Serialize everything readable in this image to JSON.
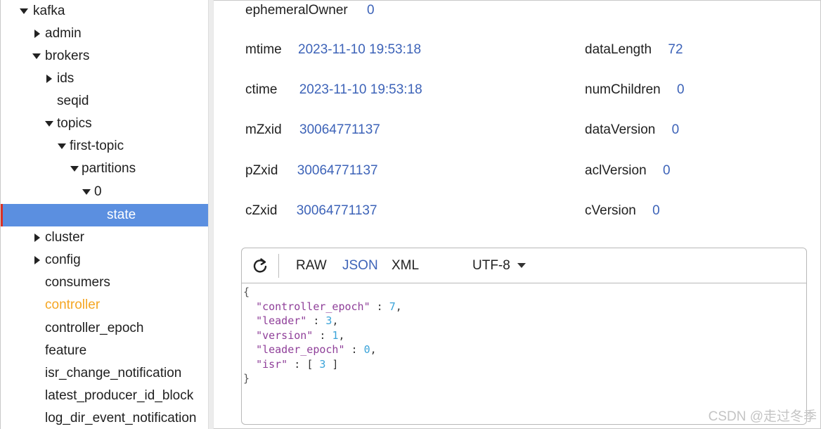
{
  "tree": {
    "items": [
      {
        "label": "kafka",
        "arrow": "down"
      },
      {
        "label": "admin",
        "arrow": "right"
      },
      {
        "label": "brokers",
        "arrow": "down"
      },
      {
        "label": "ids",
        "arrow": "right"
      },
      {
        "label": "seqid",
        "arrow": "none"
      },
      {
        "label": "topics",
        "arrow": "down"
      },
      {
        "label": "first-topic",
        "arrow": "down"
      },
      {
        "label": "partitions",
        "arrow": "down"
      },
      {
        "label": "0",
        "arrow": "down"
      },
      {
        "label": "state",
        "arrow": "none",
        "selected": true
      },
      {
        "label": "cluster",
        "arrow": "right"
      },
      {
        "label": "config",
        "arrow": "right"
      },
      {
        "label": "consumers",
        "arrow": "none"
      },
      {
        "label": "controller",
        "arrow": "none",
        "highlight": true
      },
      {
        "label": "controller_epoch",
        "arrow": "none"
      },
      {
        "label": "feature",
        "arrow": "none"
      },
      {
        "label": "isr_change_notification",
        "arrow": "none"
      },
      {
        "label": "latest_producer_id_block",
        "arrow": "none"
      },
      {
        "label": "log_dir_event_notification",
        "arrow": "none"
      }
    ]
  },
  "stat": {
    "ephemeralOwner": {
      "label": "ephemeralOwner",
      "value": "0"
    },
    "mtime": {
      "label": "mtime",
      "value": "2023-11-10 19:53:18"
    },
    "ctime": {
      "label": "ctime",
      "value": "2023-11-10 19:53:18"
    },
    "mZxid": {
      "label": "mZxid",
      "value": "30064771137"
    },
    "pZxid": {
      "label": "pZxid",
      "value": "30064771137"
    },
    "cZxid": {
      "label": "cZxid",
      "value": "30064771137"
    },
    "dataLength": {
      "label": "dataLength",
      "value": "72"
    },
    "numChildren": {
      "label": "numChildren",
      "value": "0"
    },
    "dataVersion": {
      "label": "dataVersion",
      "value": "0"
    },
    "aclVersion": {
      "label": "aclVersion",
      "value": "0"
    },
    "cVersion": {
      "label": "cVersion",
      "value": "0"
    }
  },
  "viewer": {
    "refresh_icon": "refresh-icon",
    "format_buttons": {
      "raw": "RAW",
      "json": "JSON",
      "xml": "XML"
    },
    "active_format": "JSON",
    "encoding": "UTF-8",
    "code": {
      "open": "{",
      "close": "}",
      "entries": [
        {
          "key": "\"controller_epoch\"",
          "value": "7",
          "suffix": ","
        },
        {
          "key": "\"leader\"",
          "value": "3",
          "suffix": ","
        },
        {
          "key": "\"version\"",
          "value": "1",
          "suffix": ","
        },
        {
          "key": "\"leader_epoch\"",
          "value": "0",
          "suffix": ","
        },
        {
          "key": "\"isr\"",
          "value": "[ 3 ]",
          "suffix": ""
        }
      ]
    }
  },
  "watermark": "CSDN @走过冬季",
  "colors": {
    "selected_bg": "#5b8fe0",
    "highlight_text": "#f5a623",
    "value_blue": "#3d63b8",
    "json_key": "#8f3f99",
    "json_number": "#3aa3d9"
  }
}
